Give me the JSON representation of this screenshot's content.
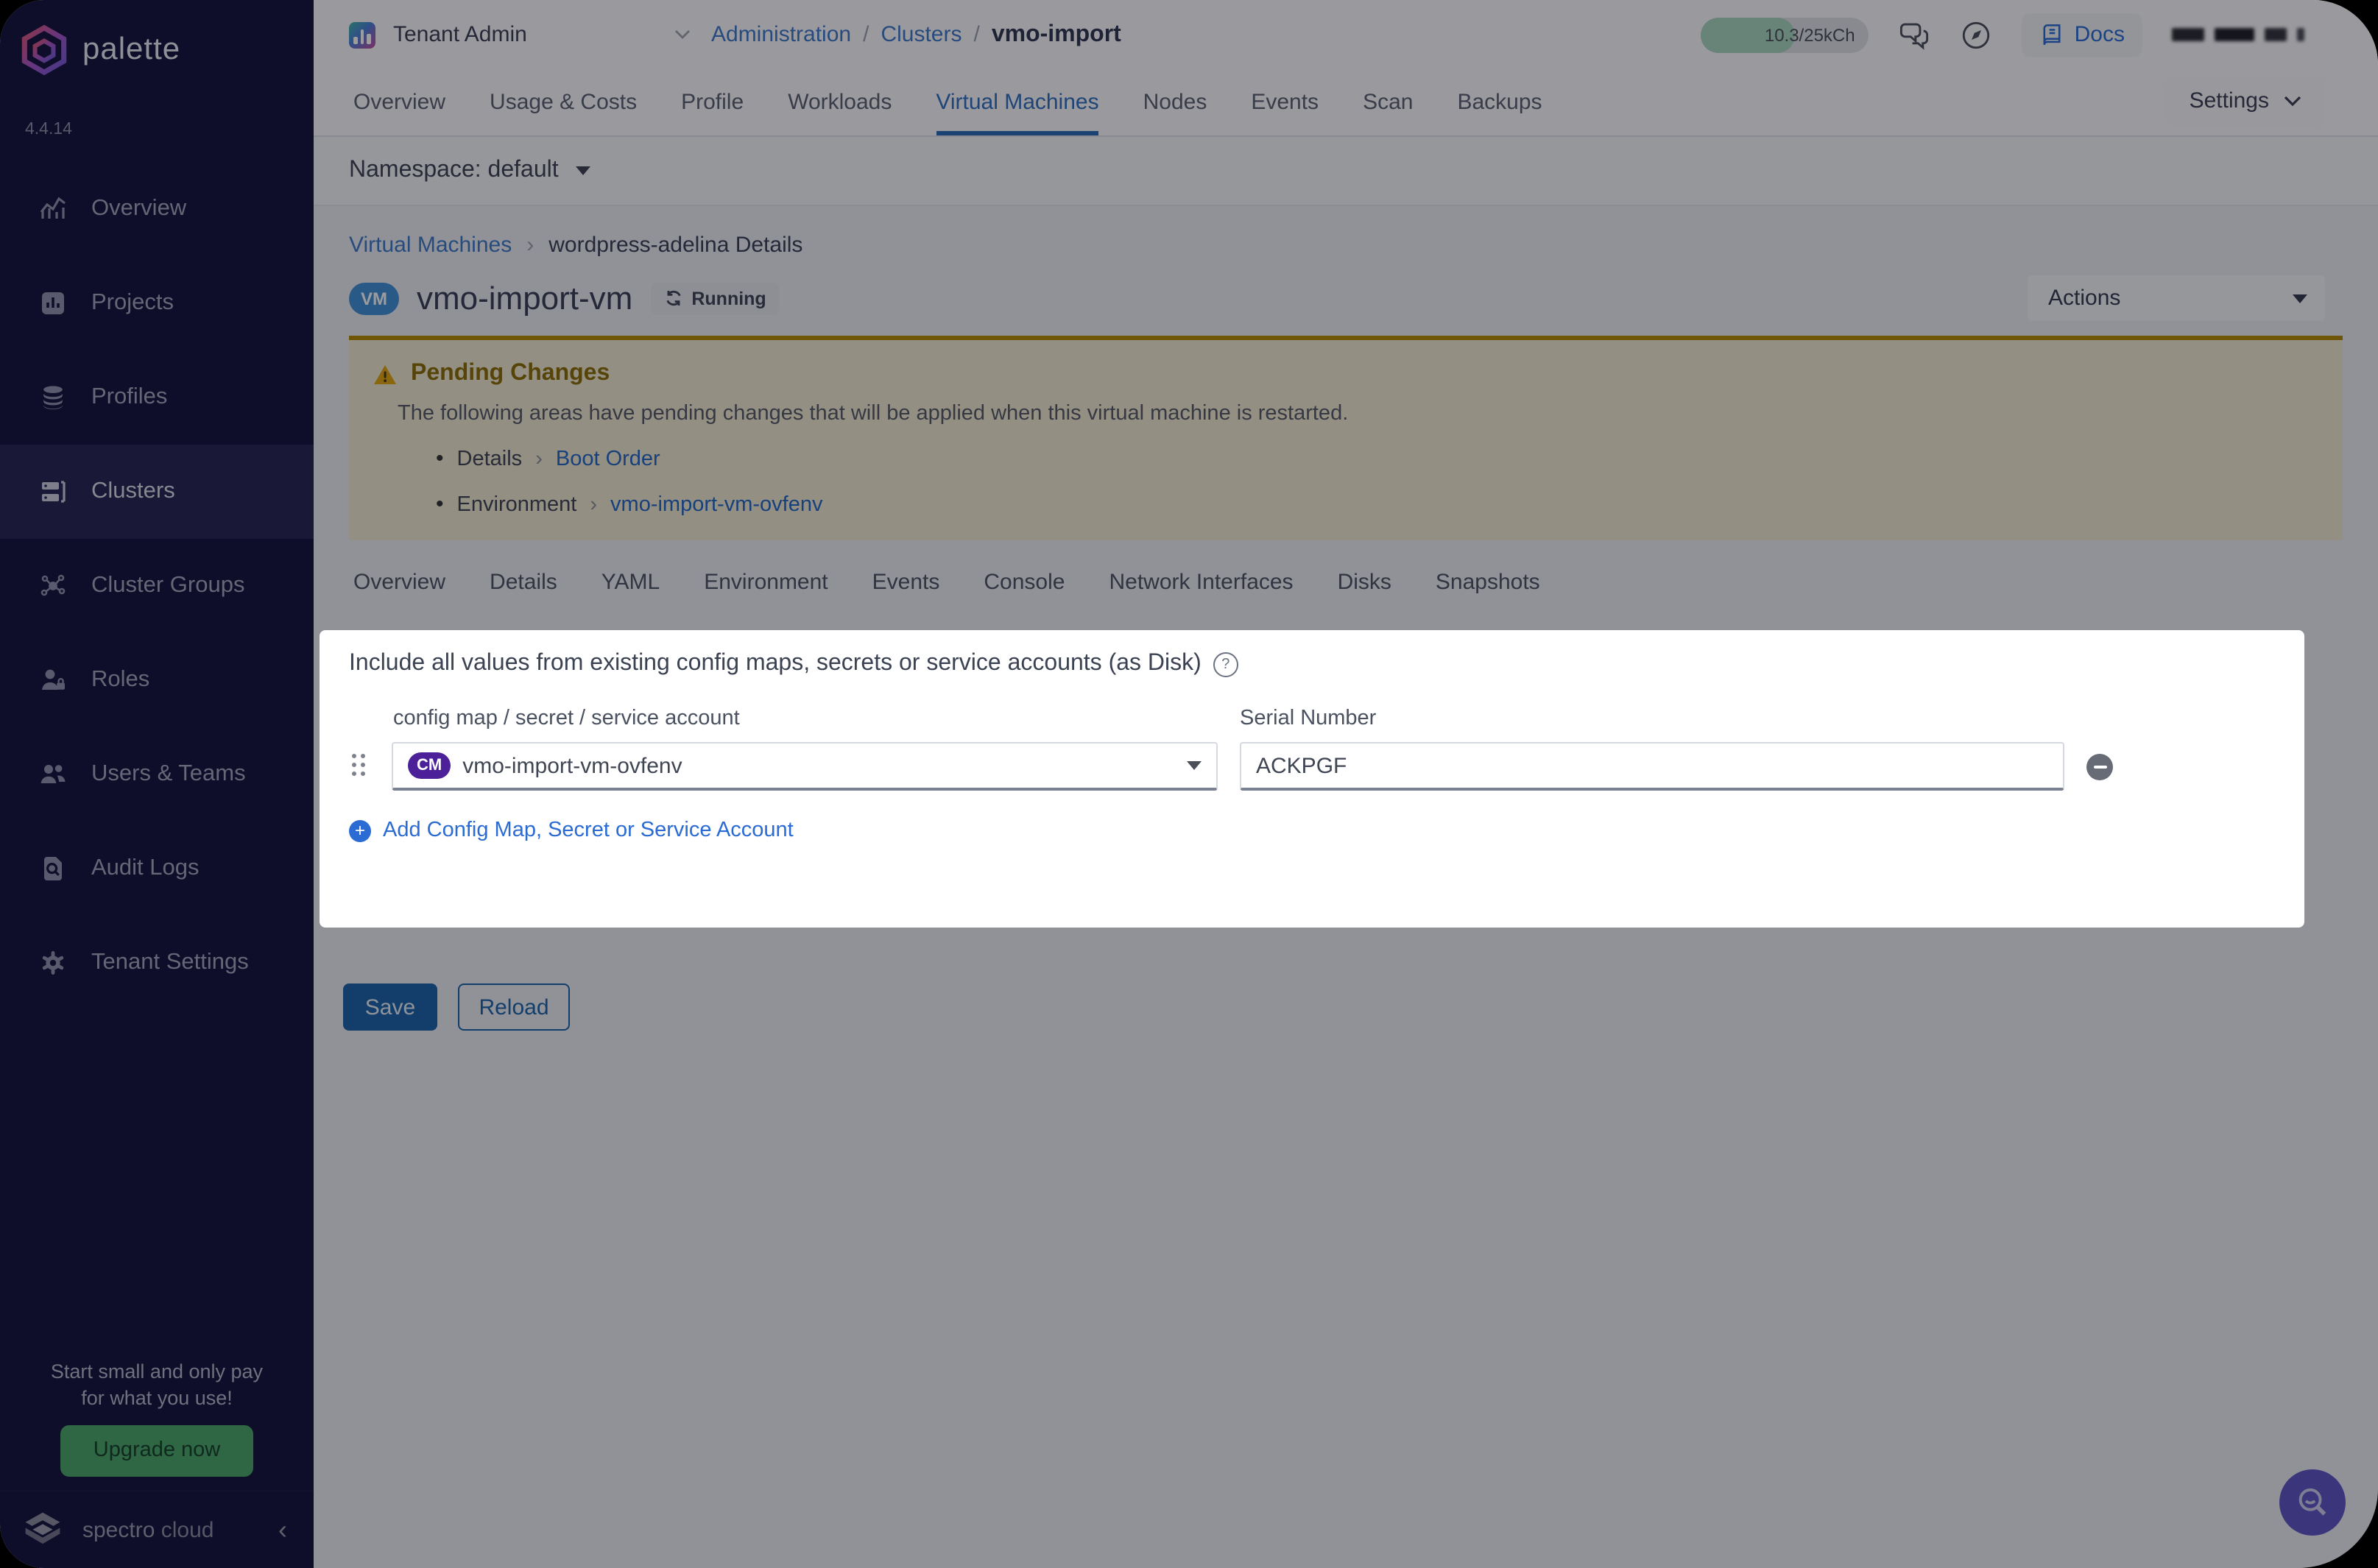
{
  "brand": {
    "name": "palette",
    "version": "4.4.14"
  },
  "topbar": {
    "project_selector": "Tenant Admin",
    "breadcrumb": {
      "level1": "Administration",
      "sep": "/",
      "level2": "Clusters",
      "current": "vmo-import"
    },
    "usage_badge": "10.3/25kCh",
    "docs_label": "Docs"
  },
  "tabs": {
    "items": [
      "Overview",
      "Usage & Costs",
      "Profile",
      "Workloads",
      "Virtual Machines",
      "Nodes",
      "Events",
      "Scan",
      "Backups"
    ],
    "active": "Virtual Machines",
    "settings_label": "Settings"
  },
  "namespace_bar": {
    "label": "Namespace: default"
  },
  "vm_header": {
    "breadcrumb_link": "Virtual Machines",
    "breadcrumb_sep": "›",
    "breadcrumb_current": "wordpress-adelina Details",
    "badge": "VM",
    "name": "vmo-import-vm",
    "status": "Running",
    "actions_label": "Actions"
  },
  "pending_changes": {
    "title": "Pending Changes",
    "message": "The following areas have pending changes that will be applied when this virtual machine is restarted.",
    "items": [
      {
        "bullet": "•",
        "area": "Details",
        "sep": "›",
        "link": "Boot Order"
      },
      {
        "bullet": "•",
        "area": "Environment",
        "sep": "›",
        "link": "vmo-import-vm-ovfenv"
      }
    ]
  },
  "vm_tabs": {
    "items": [
      "Overview",
      "Details",
      "YAML",
      "Environment",
      "Events",
      "Console",
      "Network Interfaces",
      "Disks",
      "Snapshots"
    ]
  },
  "env_panel": {
    "heading": "Include all values from existing config maps, secrets or service accounts (as Disk)",
    "help_glyph": "?",
    "column1_label": "config map / secret / service account",
    "column2_label": "Serial Number",
    "cm_badge": "CM",
    "selected_value": "vmo-import-vm-ovfenv",
    "serial_value": "ACKPGF",
    "add_link": "Add Config Map, Secret or Service Account"
  },
  "actions_bar": {
    "save": "Save",
    "reload": "Reload"
  },
  "sidebar": {
    "items": [
      {
        "label": "Overview"
      },
      {
        "label": "Projects"
      },
      {
        "label": "Profiles"
      },
      {
        "label": "Clusters"
      },
      {
        "label": "Cluster Groups"
      },
      {
        "label": "Roles"
      },
      {
        "label": "Users & Teams"
      },
      {
        "label": "Audit Logs"
      },
      {
        "label": "Tenant Settings"
      }
    ],
    "active": "Clusters"
  },
  "promo": {
    "line1": "Start small and only pay",
    "line2": "for what you use!",
    "cta": "Upgrade now"
  },
  "footer": {
    "brand_part1": "spectro",
    "brand_part2": " cloud"
  },
  "colors": {
    "accent_blue": "#2a69b8",
    "link_blue": "#2a6bd4",
    "warning_bg": "#f2ead0",
    "warning_border": "#b28a00",
    "warning_title": "#8a6d06",
    "cta_green": "#4aa568",
    "cm_badge_purple": "#4c2099",
    "vm_badge_blue": "#3f8fd8",
    "fab_purple": "#5e54c4",
    "sidebar_bg": "#15133c"
  }
}
